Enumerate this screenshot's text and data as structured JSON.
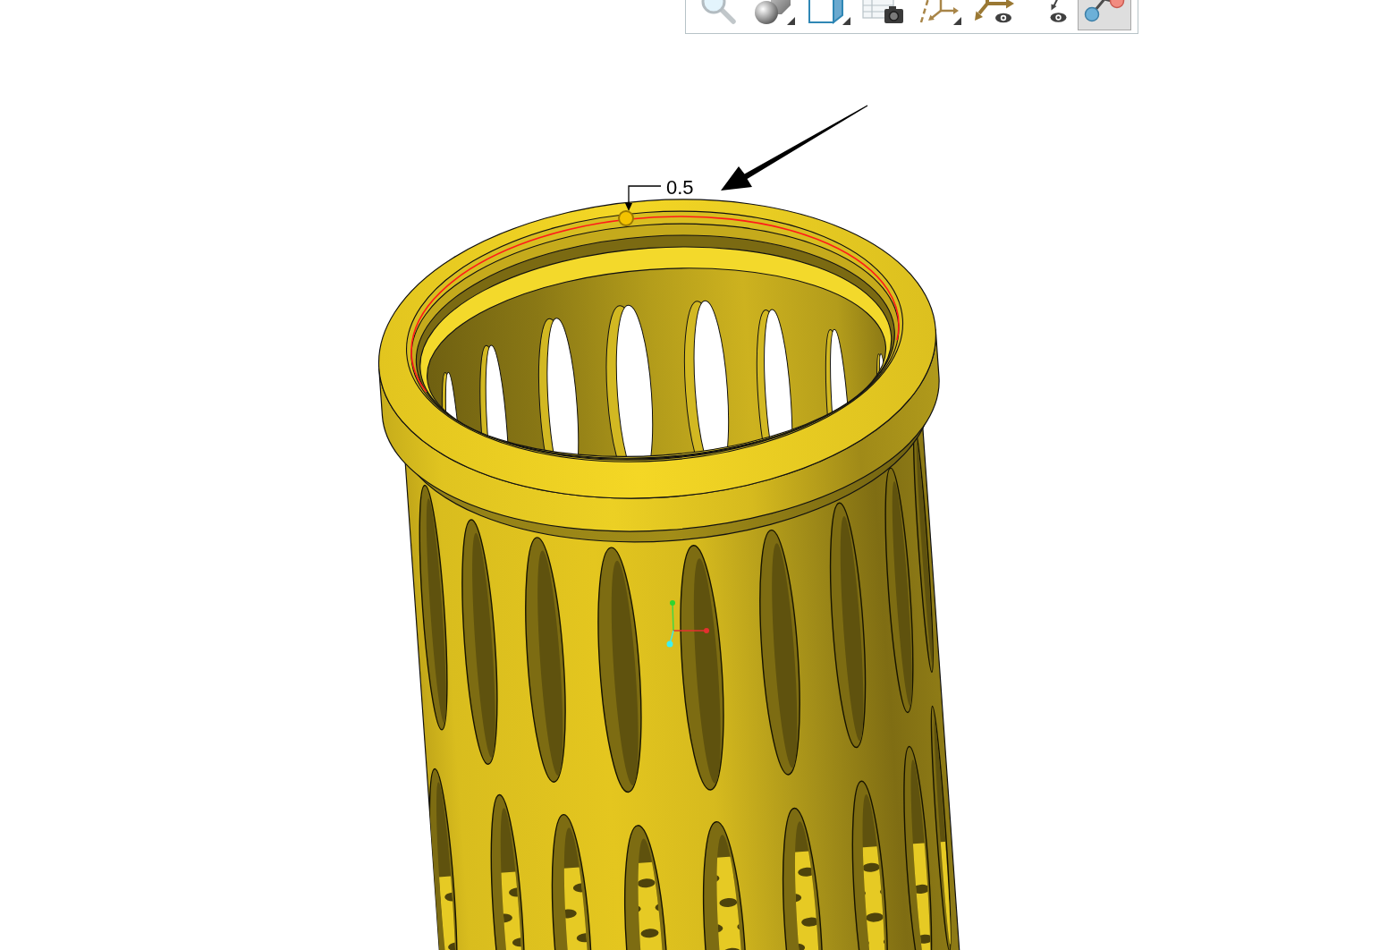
{
  "toolbar": {
    "buttons": [
      {
        "kind": "magnifier",
        "selected": false,
        "menu": false
      },
      {
        "kind": "spheres",
        "selected": false,
        "menu": true
      },
      {
        "kind": "box",
        "selected": false,
        "menu": true
      },
      {
        "kind": "camera",
        "selected": false,
        "menu": false
      },
      {
        "kind": "triad",
        "selected": false,
        "menu": true
      },
      {
        "kind": "axes",
        "selected": false,
        "menu": false
      },
      {
        "kind": "eye",
        "selected": false,
        "menu": false
      },
      {
        "kind": "nodes",
        "selected": true,
        "menu": false
      }
    ]
  },
  "dimension": {
    "value": "0.5"
  }
}
